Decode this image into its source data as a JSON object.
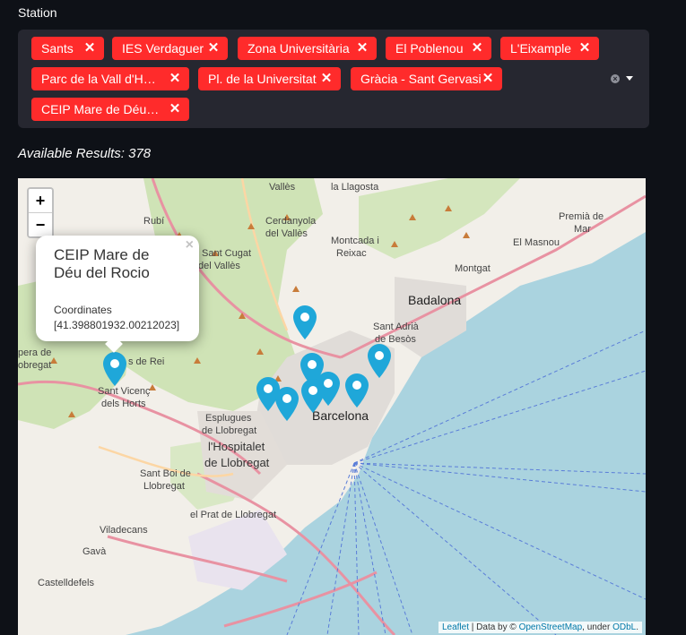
{
  "station_label": "Station",
  "tags": [
    {
      "label": "Sants"
    },
    {
      "label": "IES Verdaguer"
    },
    {
      "label": "Zona Universitària"
    },
    {
      "label": "El Poblenou"
    },
    {
      "label": "L'Eixample"
    },
    {
      "label": "Parc de la Vall d'He…"
    },
    {
      "label": "Pl. de la Universitat"
    },
    {
      "label": "Gràcia - Sant Gervasi"
    },
    {
      "label": "CEIP Mare de Déu d…"
    }
  ],
  "results_text": "Available Results: 378",
  "map": {
    "zoom_in": "+",
    "zoom_out": "−",
    "popup": {
      "title": "CEIP Mare de Déu del Rocio",
      "label": "Coordinates",
      "coords": "[41.398801932.00212023]",
      "close": "×"
    },
    "attribution": {
      "leaflet": "Leaflet",
      "data_by": "| Data by ©",
      "osm": "OpenStreetMap",
      "under": ", under",
      "odbl": "ODbL",
      "end": "."
    },
    "places": [
      {
        "text": "Vallès"
      },
      {
        "text": "la Llagosta"
      },
      {
        "text": "Rubí"
      },
      {
        "text": "Cerdanyola"
      },
      {
        "text": "del Vallès"
      },
      {
        "text": "Montcada i"
      },
      {
        "text": "Reixac"
      },
      {
        "text": "Sant Cugat"
      },
      {
        "text": "del Vallès"
      },
      {
        "text": "Badalona"
      },
      {
        "text": "Montgat"
      },
      {
        "text": "El Masnou"
      },
      {
        "text": "Premià de"
      },
      {
        "text": "Mar"
      },
      {
        "text": "Sant Adrià"
      },
      {
        "text": "de Besòs"
      },
      {
        "text": "Barcelona"
      },
      {
        "text": "Sant Vicenç"
      },
      {
        "text": "dels Horts"
      },
      {
        "text": "Esplugues"
      },
      {
        "text": "de Llobregat"
      },
      {
        "text": "l'Hospitalet"
      },
      {
        "text": "de Llobregat"
      },
      {
        "text": "Sant Boi de"
      },
      {
        "text": "Llobregat"
      },
      {
        "text": "el Prat de Llobregat"
      },
      {
        "text": "Viladecans"
      },
      {
        "text": "Gavà"
      },
      {
        "text": "Castelldefels"
      },
      {
        "text": "pera de"
      },
      {
        "text": "obregat"
      },
      {
        "text": "s de Rei"
      }
    ]
  },
  "colors": {
    "tag": "#ff2b2b",
    "marker": "#1fa7d9",
    "background": "#0e1117"
  }
}
